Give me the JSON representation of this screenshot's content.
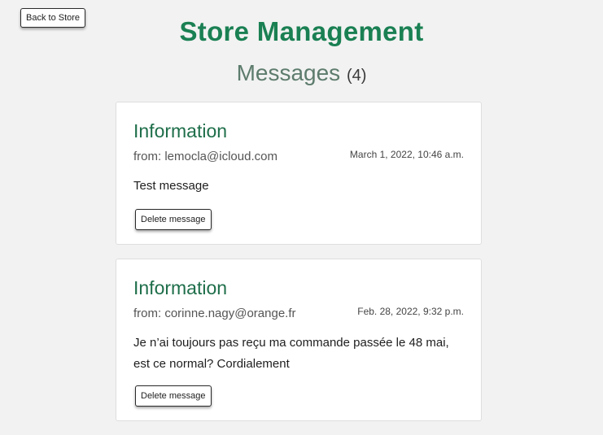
{
  "header": {
    "back_label": "Back to Store",
    "title": "Store Management"
  },
  "section": {
    "title": "Messages",
    "count": "(4)"
  },
  "messages": [
    {
      "subject": "Information",
      "from": "from: lemocla@icloud.com",
      "date": "March 1, 2022, 10:46 a.m.",
      "body": "Test message",
      "delete_label": "Delete message"
    },
    {
      "subject": "Information",
      "from": "from: corinne.nagy@orange.fr",
      "date": "Feb. 28, 2022, 9:32 p.m.",
      "body": "Je n’ai toujours pas reçu ma commande passée le 48 mai, est ce normal? Cordialement",
      "delete_label": "Delete message"
    }
  ]
}
